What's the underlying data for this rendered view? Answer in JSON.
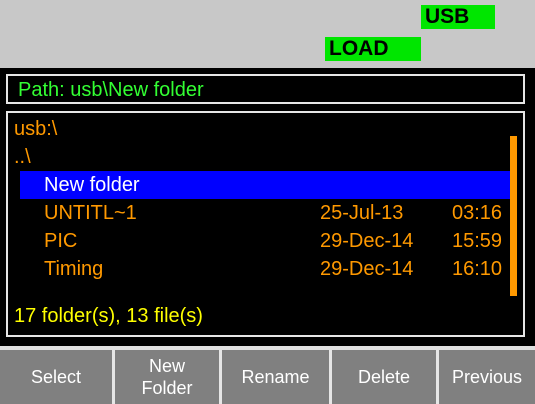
{
  "status": {
    "usb": "USB",
    "load": "LOAD"
  },
  "path": "Path: usb\\New folder",
  "files": {
    "root": "usb:\\",
    "up": "..\\",
    "selected": "New folder",
    "items": [
      {
        "name": "UNTITL~1",
        "date": "25-Jul-13",
        "time": "03:16"
      },
      {
        "name": "PIC",
        "date": "29-Dec-14",
        "time": "15:59"
      },
      {
        "name": "Timing",
        "date": "29-Dec-14",
        "time": "16:10"
      }
    ],
    "summary": "17 folder(s), 13 file(s)"
  },
  "softkeys": {
    "select": "Select",
    "new_folder_line1": "New",
    "new_folder_line2": "Folder",
    "rename": "Rename",
    "delete": "Delete",
    "previous": "Previous"
  },
  "colors": {
    "accent_green": "#00e600",
    "path_green": "#33ff33",
    "file_orange": "#ff9900",
    "selection_blue": "#0000ff",
    "summary_yellow": "#ffff00"
  }
}
